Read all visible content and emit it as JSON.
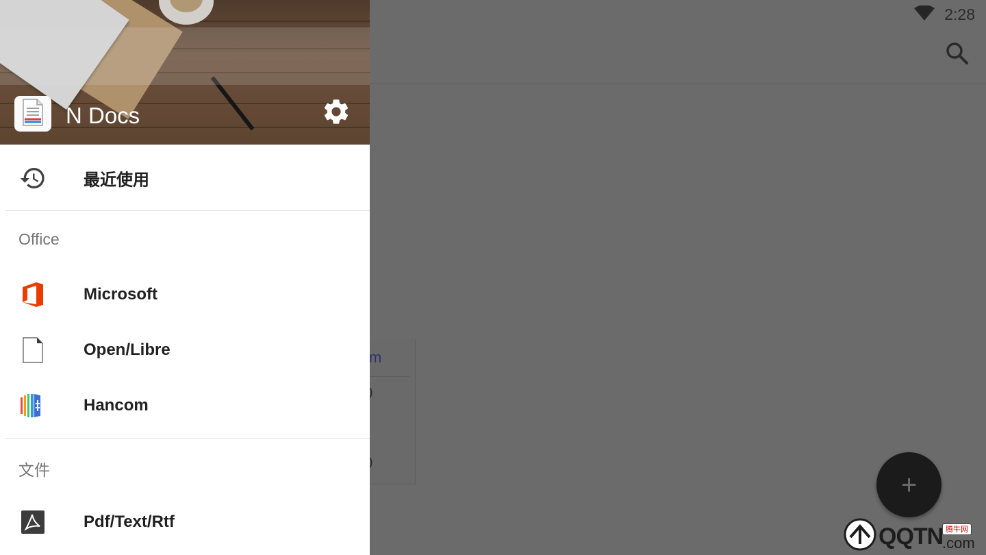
{
  "status_bar": {
    "time": "2:28"
  },
  "background_app": {
    "card_header_text": "m",
    "card_values": [
      "0",
      "0"
    ]
  },
  "drawer": {
    "app_title": "N Docs",
    "recent_label": "最近使用",
    "office_section": {
      "header": "Office",
      "items": [
        {
          "label": "Microsoft",
          "icon": "microsoft-office-icon"
        },
        {
          "label": "Open/Libre",
          "icon": "libreoffice-document-icon"
        },
        {
          "label": "Hancom",
          "icon": "hancom-icon"
        }
      ]
    },
    "files_section": {
      "header": "文件",
      "items": [
        {
          "label": "Pdf/Text/Rtf",
          "icon": "pdf-icon"
        }
      ]
    }
  },
  "fab": {
    "label": "+"
  },
  "watermark": {
    "text": "QQTN",
    "badge": "腾牛网",
    "suffix": ".com"
  },
  "colors": {
    "scrim": "#6b6b6b",
    "drawer_bg": "#ffffff",
    "office_orange": "#eb3c00",
    "pdf_dark": "#3c3c3c",
    "text_primary": "#212121",
    "text_secondary": "#757575"
  }
}
